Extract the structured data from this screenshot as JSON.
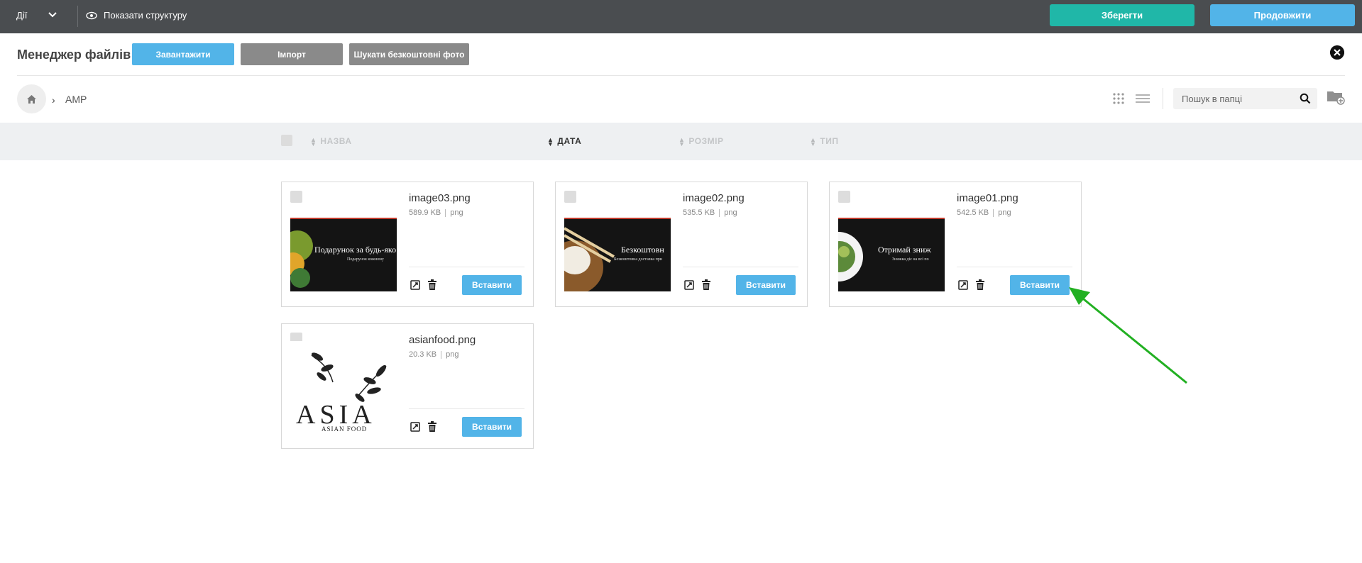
{
  "topbar": {
    "actions_label": "Дії",
    "show_structure_label": "Показати структуру",
    "save_label": "Зберегти",
    "continue_label": "Продовжити"
  },
  "header": {
    "title": "Менеджер файлів",
    "upload_label": "Завантажити",
    "import_label": "Імпорт",
    "free_photos_label": "Шукати безкоштовні фото"
  },
  "breadcrumb": {
    "current": "AMP"
  },
  "search": {
    "placeholder": "Пошук в папці"
  },
  "columns": {
    "name": "НАЗВА",
    "date": "ДАТА",
    "size": "РОЗМІР",
    "type": "ТИП"
  },
  "files": [
    {
      "name": "image03.png",
      "size": "589.9 KB",
      "type": "png",
      "insert_label": "Вставити",
      "thumb_text": "Подарунок за будь-яко",
      "thumb_sub": "Подарунок кожному"
    },
    {
      "name": "image02.png",
      "size": "535.5 KB",
      "type": "png",
      "insert_label": "Вставити",
      "thumb_text": "Безкоштовн",
      "thumb_sub": "Безкоштовна доставка при"
    },
    {
      "name": "image01.png",
      "size": "542.5 KB",
      "type": "png",
      "insert_label": "Вставити",
      "thumb_text": "Отримай зниж",
      "thumb_sub": "Знижка діє на всі по"
    },
    {
      "name": "asianfood.png",
      "size": "20.3 KB",
      "type": "png",
      "insert_label": "Вставити",
      "thumb_text": "ASIA",
      "thumb_sub": "ASIAN FOOD"
    }
  ],
  "colors": {
    "topbar": "#4a4d50",
    "save": "#20b7a8",
    "primary": "#52b4e8",
    "secondary_button": "#8a8a8a",
    "annotation_arrow": "#22b022"
  }
}
